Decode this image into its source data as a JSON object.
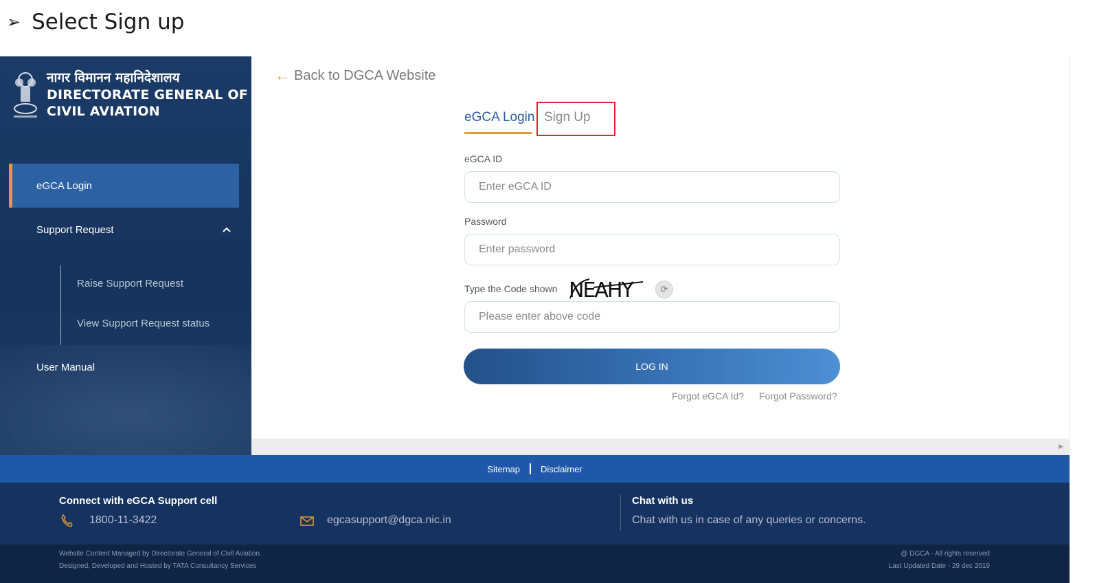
{
  "instruction": {
    "bullet": "➢",
    "text": "Select Sign up"
  },
  "brand": {
    "hindi": "नागर विमानन महानिदेशालय",
    "line1": "DIRECTORATE GENERAL OF",
    "line2": "CIVIL AVIATION"
  },
  "sidebar": {
    "items": [
      {
        "label": "eGCA Login"
      },
      {
        "label": "Support Request"
      },
      {
        "label": "User Manual"
      }
    ],
    "sub_items": [
      {
        "label": "Raise Support Request"
      },
      {
        "label": "View Support Request status"
      }
    ]
  },
  "back_link": {
    "arrow": "←",
    "label": "Back to DGCA Website"
  },
  "tabs": {
    "login": "eGCA Login",
    "signup": "Sign Up"
  },
  "form": {
    "id_label": "eGCA ID",
    "id_placeholder": "Enter eGCA ID",
    "password_label": "Password",
    "password_placeholder": "Enter password",
    "captcha_label": "Type the Code shown",
    "captcha_text": "NEAHY",
    "captcha_placeholder": "Please enter above code",
    "login_button": "LOG IN",
    "forgot_id": "Forgot eGCA Id?",
    "forgot_password": "Forgot Password?"
  },
  "footer": {
    "links": {
      "sitemap": "Sitemap",
      "disclaimer": "Disclaimer"
    },
    "connect_title": "Connect with eGCA Support cell",
    "phone": "1800-11-3422",
    "email": "egcasupport@dgca.nic.in",
    "chat_title": "Chat with us",
    "chat_text": "Chat with us in case of any queries or concerns.",
    "left_line1": "Website Content Managed by Directorate General of Civil Aviation.",
    "left_line2": "Designed, Developed and Hosted by TATA Consultancy Services",
    "right_line1": "@ DGCA - All rights reserved",
    "right_line2": "Last Updated Date - 29 dec 2019"
  },
  "colors": {
    "accent_orange": "#e39a3b",
    "sidebar_bg": "#1b3b67",
    "active_blue": "#2c62a4",
    "highlight_red": "#e0242a",
    "footer_blue": "#1f58a8"
  }
}
